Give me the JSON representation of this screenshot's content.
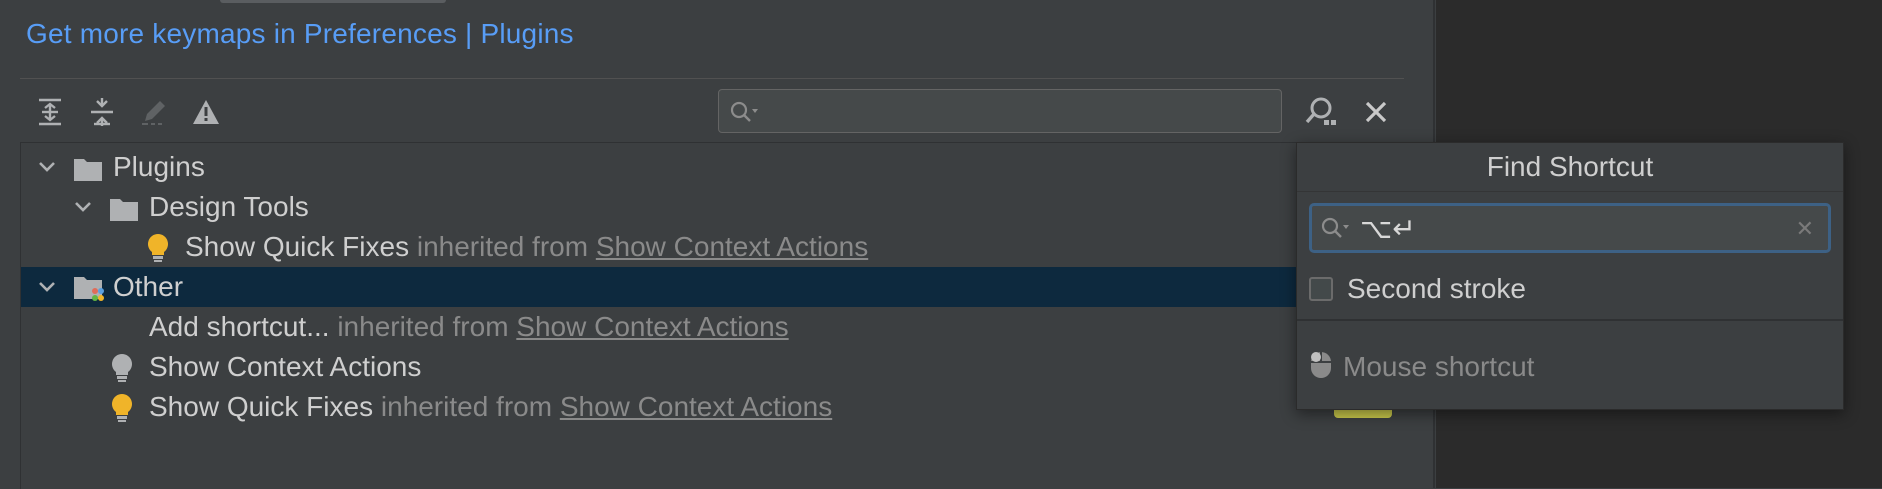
{
  "header": {
    "keymaps_link": "Get more keymaps in Preferences | Plugins"
  },
  "toolbar": {
    "icons": [
      "expand-all-icon",
      "collapse-all-icon",
      "edit-icon",
      "warning-icon"
    ],
    "search_placeholder": "",
    "search_value": ""
  },
  "tree": {
    "rows": [
      {
        "label": "Plugins"
      },
      {
        "label": "Design Tools"
      },
      {
        "label": "Show Quick Fixes",
        "suffix": "inherited from",
        "link": "Show Context Actions"
      },
      {
        "label": "Other"
      },
      {
        "label": "Add shortcut...",
        "suffix": "inherited from",
        "link": "Show Context Actions"
      },
      {
        "label": "Show Context Actions"
      },
      {
        "label": "Show Quick Fixes",
        "suffix": "inherited from",
        "link": "Show Context Actions"
      }
    ]
  },
  "find_shortcut": {
    "title": "Find Shortcut",
    "value": "⌥↵",
    "clear": "✕",
    "second_stroke_label": "Second stroke",
    "second_stroke_checked": false,
    "mouse_shortcut_label": "Mouse shortcut"
  },
  "colors": {
    "background": "#3c3f41",
    "selected_row": "#0d293e",
    "link_blue": "#589df6",
    "bulb_yellow": "#f0b429",
    "focus_border": "#3d6185"
  }
}
